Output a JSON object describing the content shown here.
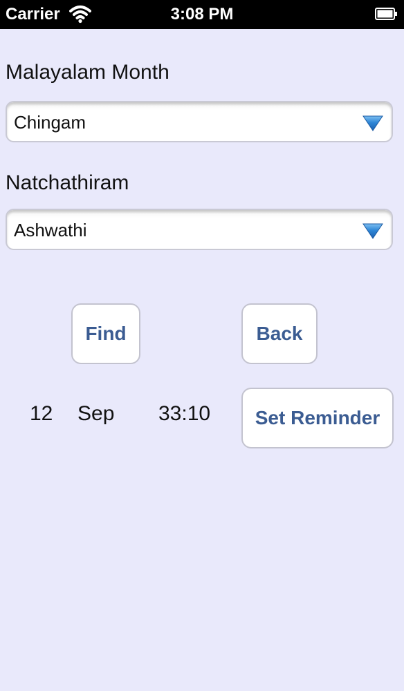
{
  "status_bar": {
    "carrier": "Carrier",
    "time": "3:08 PM",
    "icons": [
      "wifi-icon",
      "battery-icon"
    ]
  },
  "form": {
    "month_label": "Malayalam Month",
    "month_value": "Chingam",
    "star_label": "Natchathiram",
    "star_value": "Ashwathi"
  },
  "buttons": {
    "find": "Find",
    "back": "Back",
    "set_reminder": "Set Reminder"
  },
  "result": {
    "day": "12",
    "month": "Sep",
    "time": "33:10"
  },
  "colors": {
    "background": "#e9e9fb",
    "button_text": "#3b5c92",
    "dropdown_arrow": "#2e86d6"
  }
}
